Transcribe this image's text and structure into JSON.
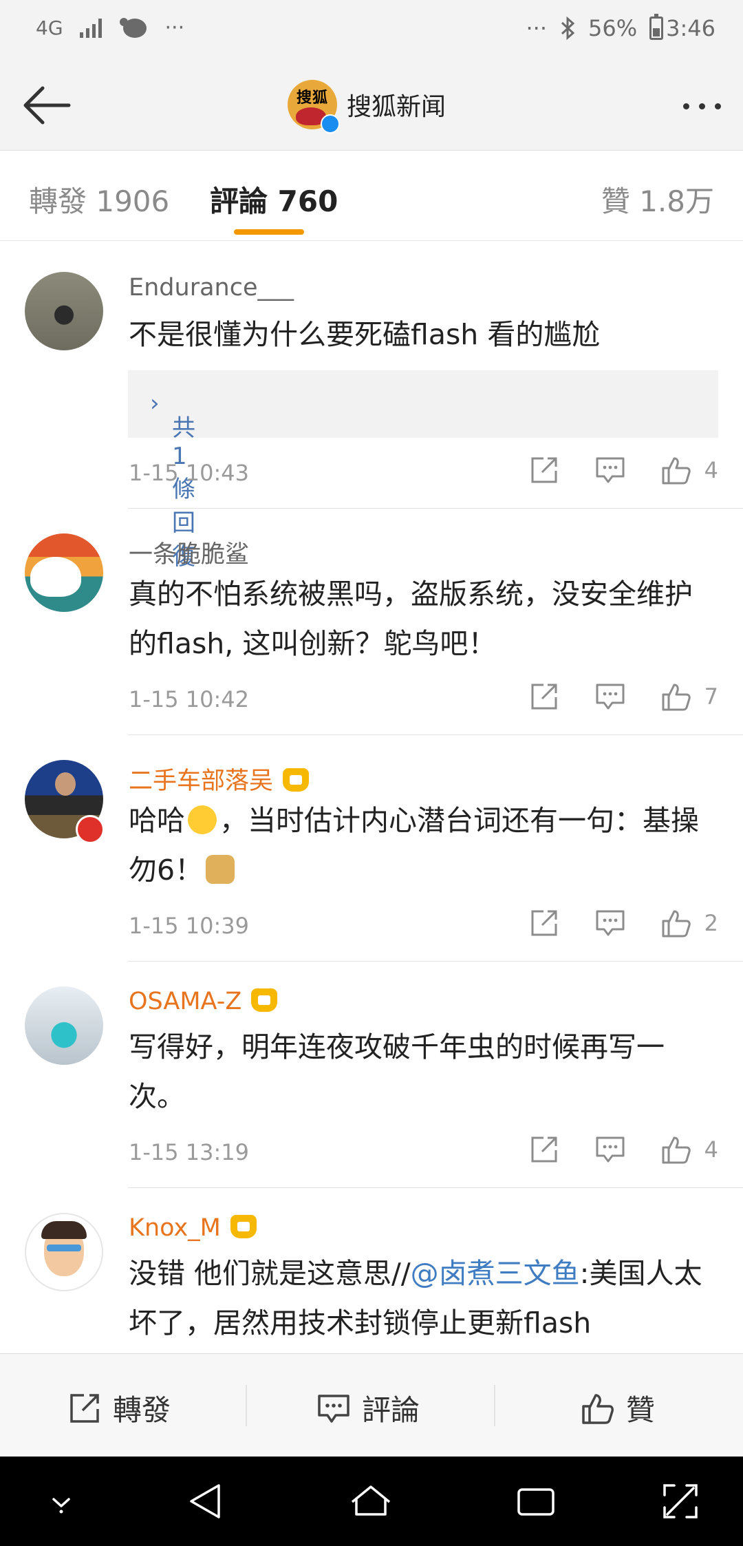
{
  "status_bar": {
    "network": "4G",
    "overflow": "···",
    "overflow_right": "···",
    "battery": "56%",
    "battery_level": 0.56,
    "time": "3:46"
  },
  "header": {
    "title": "搜狐新闻",
    "logo_text": "搜狐",
    "icons": [
      "back-arrow-icon",
      "more-dots-icon"
    ]
  },
  "tabs": [
    {
      "label": "轉發 1906"
    },
    {
      "label": "評論 760",
      "active": true
    },
    {
      "label": "贊 1.8万"
    }
  ],
  "comments": [
    {
      "username": "Endurance___",
      "vip": false,
      "text": "不是很懂为什么要死磕flash 看的尴尬",
      "replies": "共1條回復",
      "time": "1-15 10:43",
      "likes": "4"
    },
    {
      "username": "一条脆脆鲨",
      "vip": false,
      "text": "真的不怕系统被黑吗，盗版系统，没安全维护的flash, 这叫创新？鸵鸟吧！",
      "time": "1-15 10:42",
      "likes": "7"
    },
    {
      "username": "二手车部落吴",
      "vip": true,
      "text_a": "哈哈",
      "text_b": "，当时估计内心潜台词还有一句：基操勿6！",
      "time": "1-15 10:39",
      "likes": "2"
    },
    {
      "username": "OSAMA-Z",
      "vip": true,
      "text": "写得好，明年连夜攻破千年虫的时候再写一次。",
      "time": "1-15 13:19",
      "likes": "4"
    },
    {
      "username": "Knox_M",
      "vip": true,
      "text_a": "没错 他们就是这意思//",
      "mention": "@卤煮三文鱼",
      "text_b": ":美国人太坏了，居然用技术封锁停止更新flash"
    }
  ],
  "bottom_bar": {
    "repost": "轉發",
    "comment": "評論",
    "like": "贊"
  },
  "colors": {
    "accent": "#f39800",
    "vip_name": "#e8741e",
    "link": "#3f7cc1",
    "status_bg": "#f3f3f3"
  }
}
